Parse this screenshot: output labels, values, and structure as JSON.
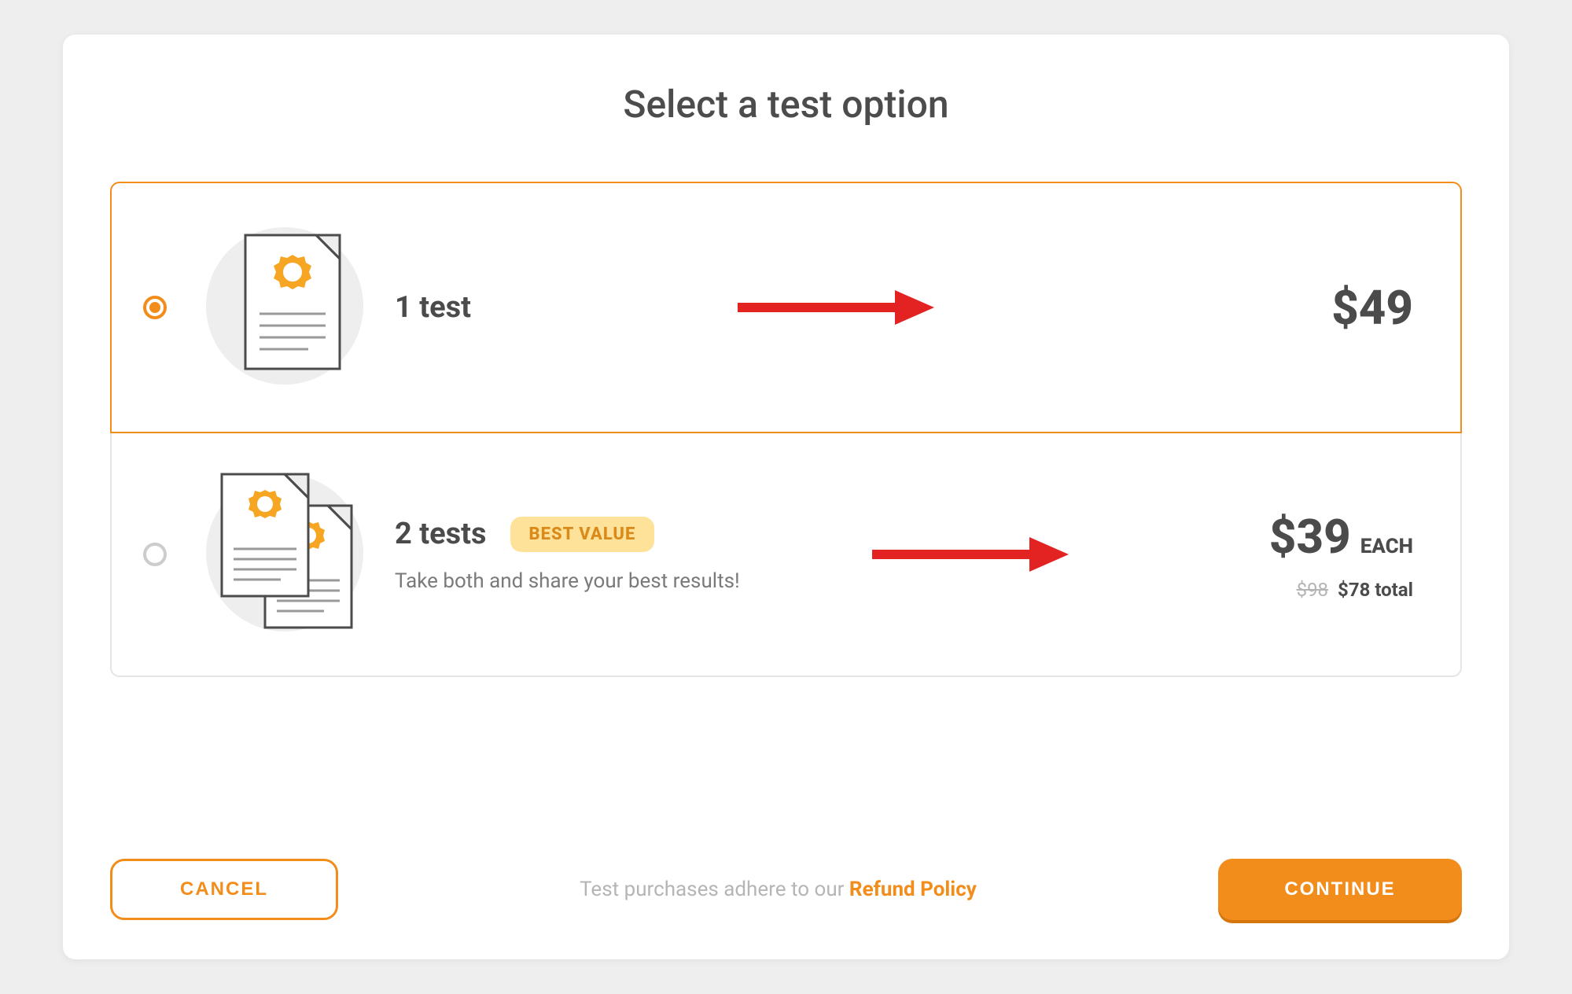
{
  "title": "Select a test option",
  "options": [
    {
      "label": "1 test",
      "price": "$49",
      "selected": true
    },
    {
      "label": "2 tests",
      "badge": "BEST VALUE",
      "subtitle": "Take both and share your best results!",
      "price": "$39",
      "price_suffix": "EACH",
      "price_strike": "$98",
      "price_total": "$78 total",
      "selected": false
    }
  ],
  "footer": {
    "cancel": "CANCEL",
    "continue": "CONTINUE",
    "policy_prefix": "Test purchases adhere to our ",
    "policy_link": "Refund Policy"
  },
  "colors": {
    "accent": "#f28c1a",
    "arrow": "#e32222"
  }
}
